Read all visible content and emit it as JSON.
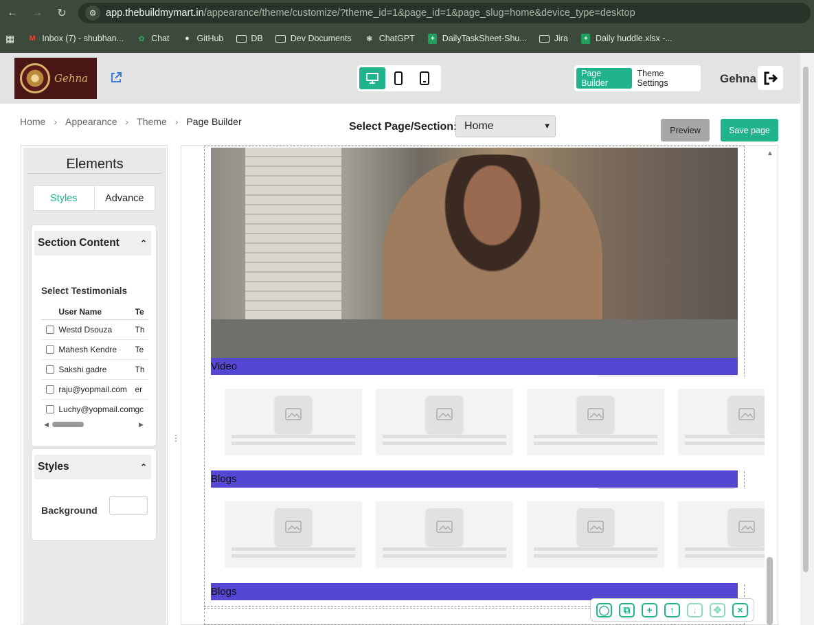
{
  "browser": {
    "url_host": "app.thebuildmymart.in",
    "url_rest": "/appearance/theme/customize/?theme_id=1&page_id=1&page_slug=home&device_type=desktop",
    "bookmarks": [
      {
        "label": "Inbox (7) - shubhan...",
        "icon": "gmail-icon"
      },
      {
        "label": "Chat",
        "icon": "chat-icon"
      },
      {
        "label": "GitHub",
        "icon": "github-icon"
      },
      {
        "label": "DB",
        "icon": "folder-icon"
      },
      {
        "label": "Dev Documents",
        "icon": "folder-icon"
      },
      {
        "label": "ChatGPT",
        "icon": "chatgpt-icon"
      },
      {
        "label": "DailyTaskSheet-Shu...",
        "icon": "sheets-icon"
      },
      {
        "label": "Jira",
        "icon": "folder-icon"
      },
      {
        "label": "Daily huddle.xlsx -...",
        "icon": "sheets-icon"
      }
    ]
  },
  "header": {
    "logo_text": "Gehna",
    "page_builder_label": "Page Builder",
    "theme_settings_label": "Theme Settings",
    "user_name": "Gehna",
    "accent": "#20b48c"
  },
  "breadcrumb": [
    "Home",
    "Appearance",
    "Theme",
    "Page Builder"
  ],
  "page_select": {
    "label": "Select Page/Section:",
    "value": "Home"
  },
  "actions": {
    "preview": "Preview",
    "save": "Save page"
  },
  "elements_panel": {
    "title": "Elements",
    "tabs": [
      "Styles",
      "Advance"
    ],
    "section_content_title": "Section Content",
    "select_label": "Select Testimonials",
    "columns": [
      "User Name",
      "Te"
    ],
    "rows": [
      {
        "name": "Westd Dsouza",
        "text": "Th"
      },
      {
        "name": "Mahesh Kendre",
        "text": "Te"
      },
      {
        "name": "Sakshi gadre",
        "text": "Th"
      },
      {
        "name": "raju@yopmail.com",
        "text": "er"
      },
      {
        "name": "Luchy@yopmail.com",
        "text": "gc"
      }
    ],
    "styles_title": "Styles",
    "background_label": "Background"
  },
  "canvas": {
    "sections": [
      "Video",
      "Blogs",
      "Blogs"
    ],
    "section_color": "#5646d4"
  }
}
